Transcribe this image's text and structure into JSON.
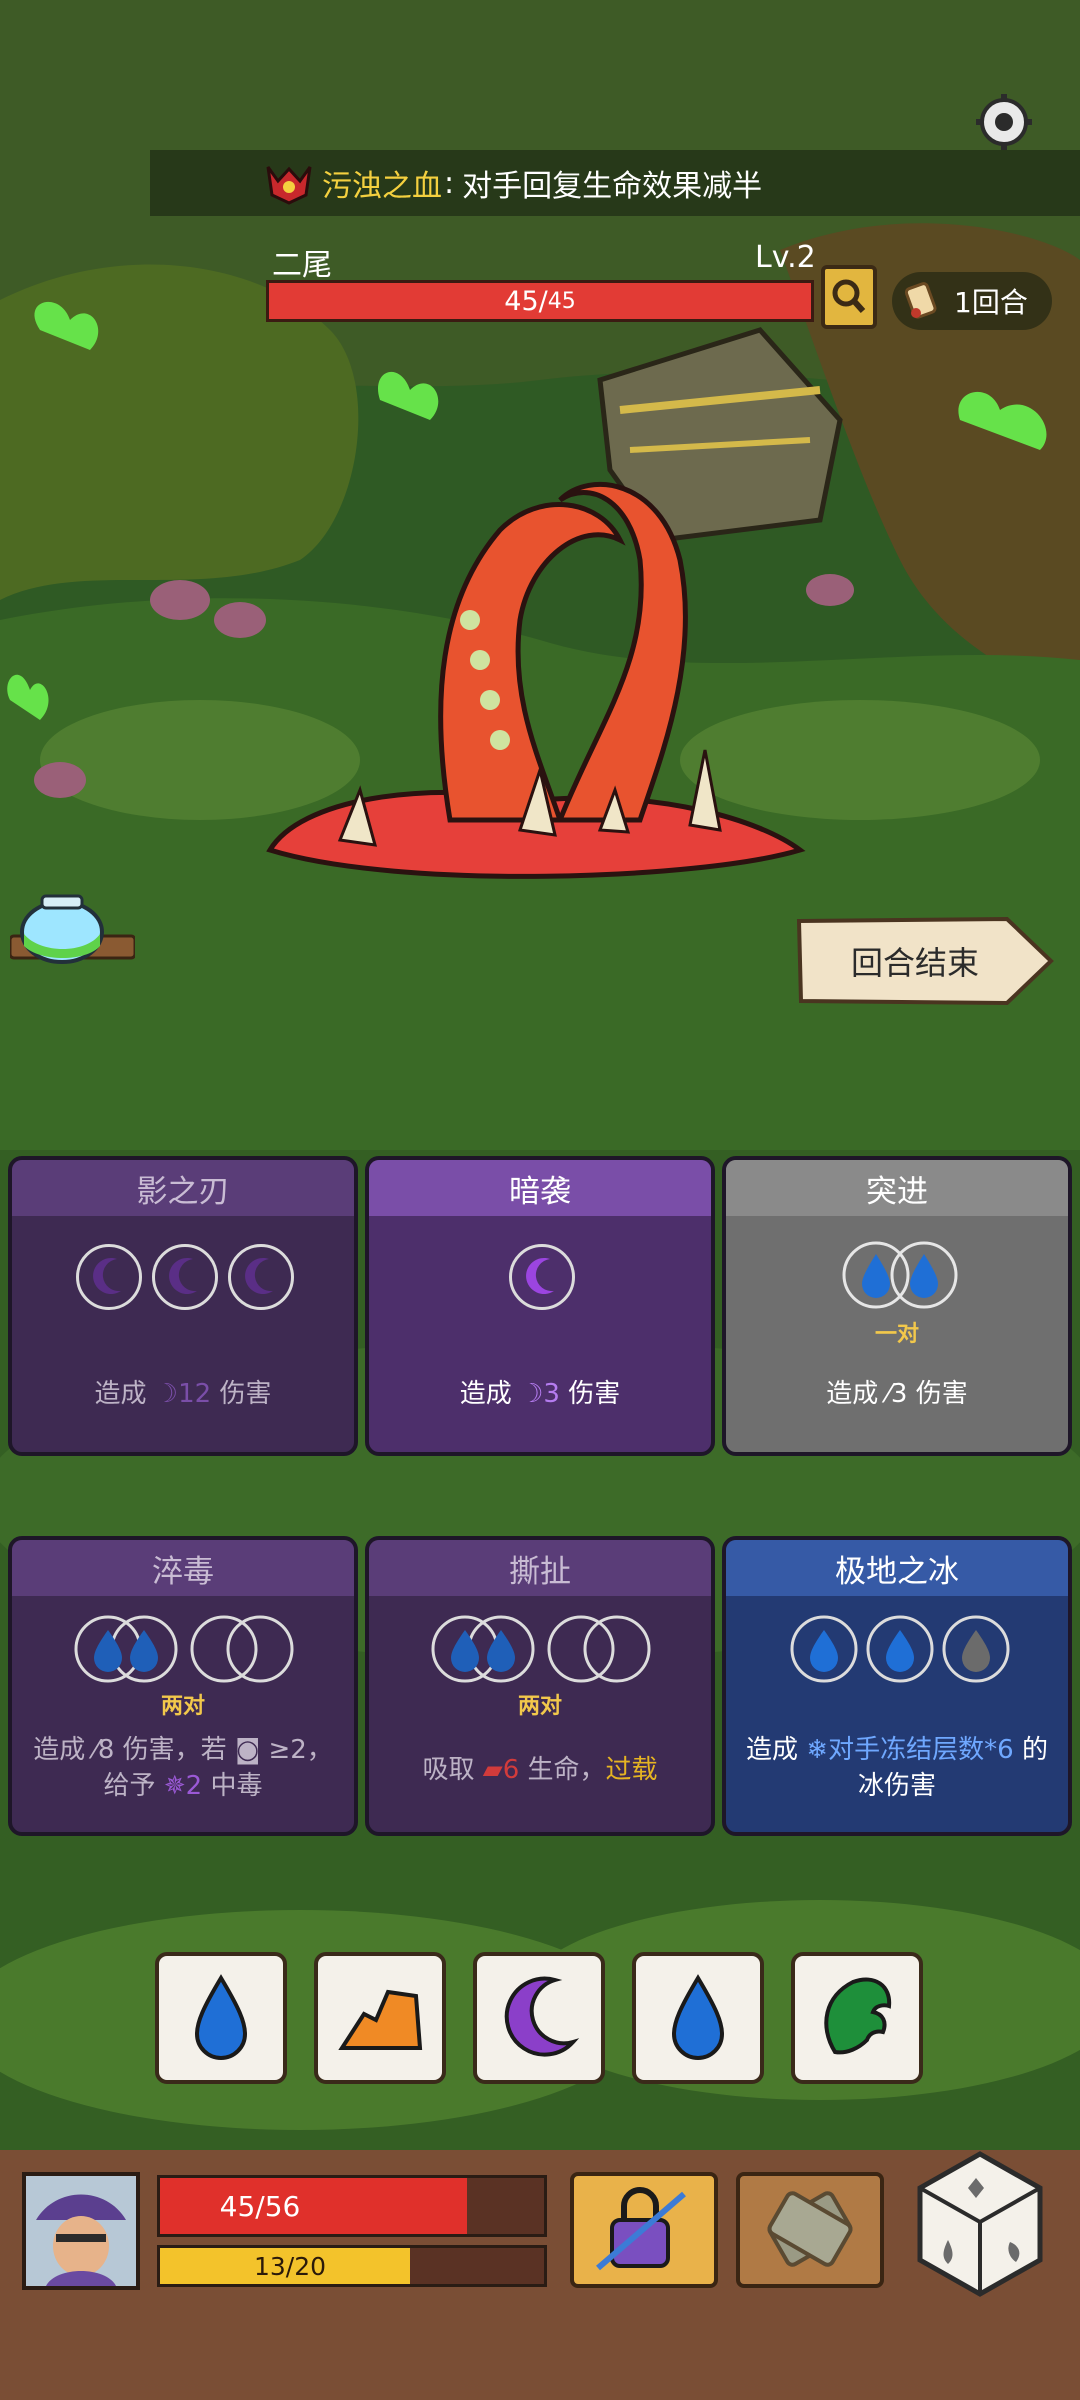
{
  "status_effect": {
    "icon": "blood-curse-icon",
    "name": "污浊之血",
    "separator": ":",
    "description": "对手回复生命效果减半"
  },
  "enemy": {
    "name": "二尾",
    "level": "Lv.2",
    "hp_current": "45",
    "hp_sep": " /",
    "hp_max": "45"
  },
  "round": {
    "label": "1回合"
  },
  "end_turn": {
    "label": "回合结束"
  },
  "cards": [
    {
      "title": "影之刃",
      "desc_prefix": "造成",
      "desc_value": "12",
      "desc_suffix": "伤害",
      "state": "dimmed"
    },
    {
      "title": "暗袭",
      "desc_prefix": "造成",
      "desc_value": "3",
      "desc_suffix": "伤害",
      "state": "active"
    },
    {
      "title": "突进",
      "pair_label": "一对",
      "desc_prefix": "造成",
      "desc_value": "3",
      "desc_suffix": "伤害",
      "state": "active"
    },
    {
      "title": "淬毒",
      "pair_label": "两对",
      "desc_line1": "造成",
      "desc_line1_value": "8",
      "desc_line1_mid": "伤害，若",
      "desc_line1_cond": "≥2，",
      "desc_line2_prefix": "给予",
      "desc_line2_value": "2",
      "desc_line2_suffix": "中毒",
      "state": "dimmed"
    },
    {
      "title": "撕扯",
      "pair_label": "两对",
      "desc_prefix": "吸取",
      "desc_value": "6",
      "desc_mid": "生命，",
      "desc_keyword": "过载",
      "state": "dimmed"
    },
    {
      "title": "极地之冰",
      "desc_prefix": "造成",
      "desc_highlight": "对手冻结层数*6",
      "desc_suffix": "的",
      "desc_line2": "冰伤害",
      "state": "active"
    }
  ],
  "dice": [
    {
      "face": "water-drop",
      "color": "#1f6fd6"
    },
    {
      "face": "earth-shard",
      "color": "#f08a25"
    },
    {
      "face": "moon",
      "color": "#8b3fc9"
    },
    {
      "face": "water-drop",
      "color": "#1f6fd6"
    },
    {
      "face": "leaf",
      "color": "#1e8f3a"
    }
  ],
  "player": {
    "hp_text": "45/56",
    "hp_fraction": 0.8,
    "energy_text": "13/20",
    "energy_fraction": 0.65
  },
  "colors": {
    "enemy_hp": "#e23b35",
    "player_hp": "#e0302b",
    "player_energy": "#f3c32b",
    "pair_label": "#f2c84b",
    "curse_name": "#f4d03f",
    "overload": "#e6b422",
    "ice_highlight": "#6fa8ff"
  }
}
